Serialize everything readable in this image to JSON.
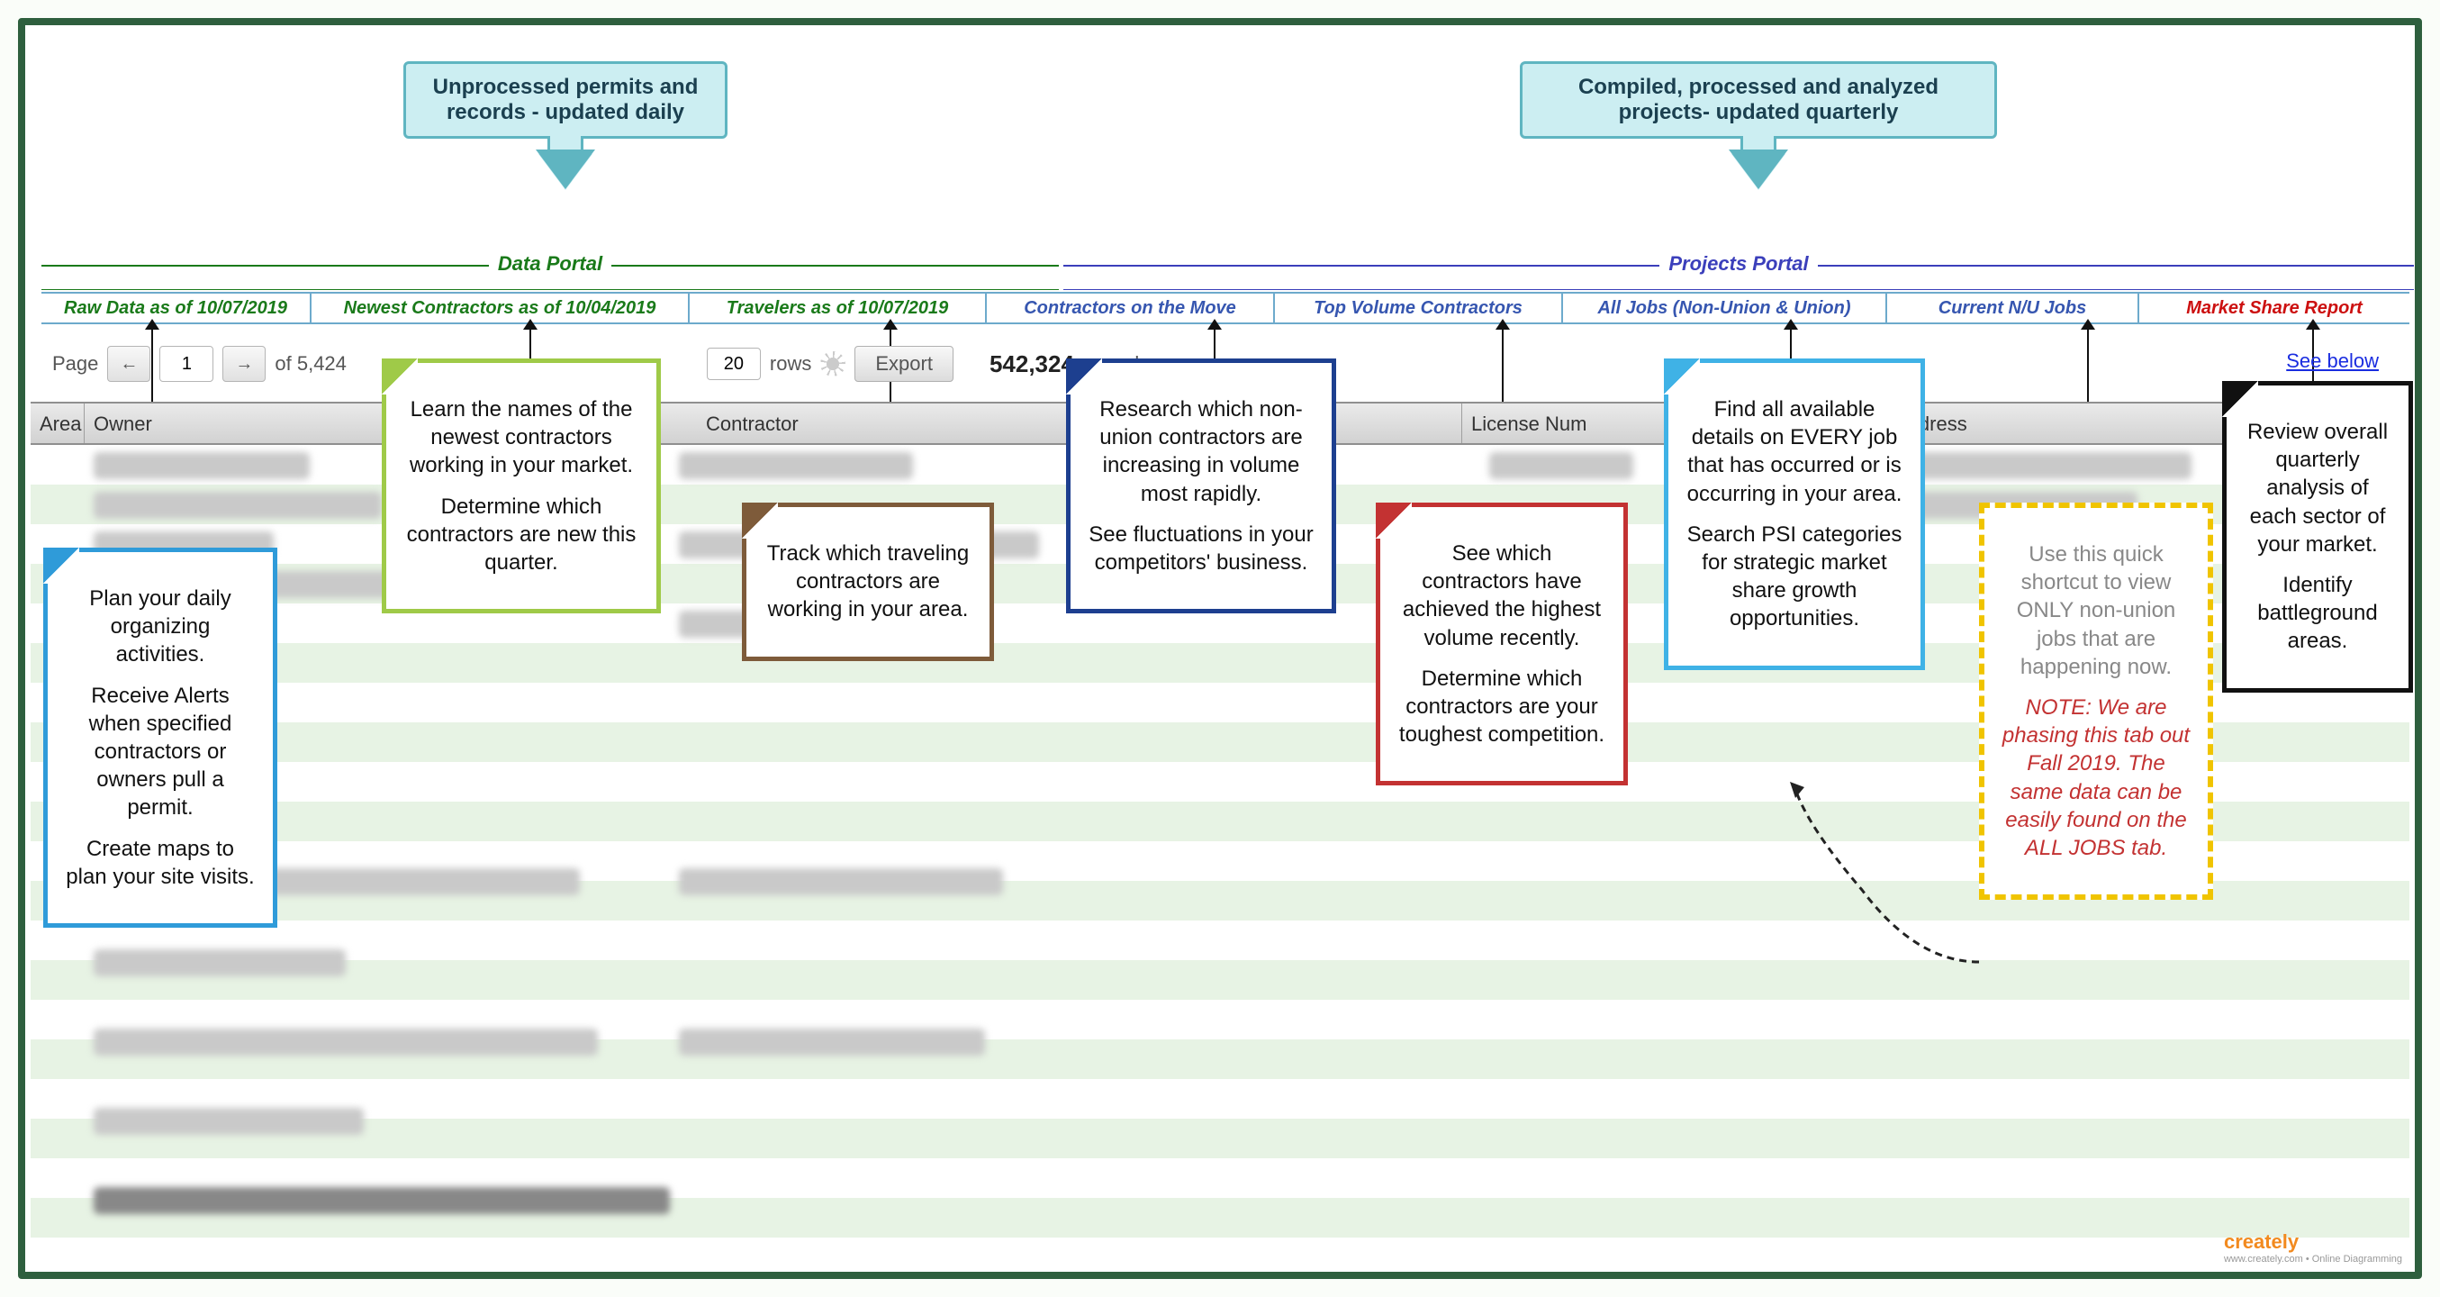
{
  "top_callouts": {
    "left": "Unprocessed permits and records - updated daily",
    "right": "Compiled, processed and analyzed projects- updated quarterly"
  },
  "portals": {
    "data": "Data Portal",
    "projects": "Projects Portal"
  },
  "tabs": {
    "raw_data": "Raw Data as of 10/07/2019",
    "newest_contractors": "Newest Contractors as of 10/04/2019",
    "travelers": "Travelers as of 10/07/2019",
    "contractors_move": "Contractors on the Move",
    "top_volume": "Top Volume Contractors",
    "all_jobs": "All Jobs (Non-Union & Union)",
    "current_nu": "Current N/U Jobs",
    "market_share": "Market Share Report"
  },
  "pager": {
    "page_label": "Page",
    "page_value": "1",
    "total_pages": "of 5,424",
    "rows_value": "20",
    "rows_label": "rows",
    "export": "Export",
    "record_count": "542,324",
    "record_label": "records"
  },
  "see_below": "See below",
  "columns": {
    "area": "Area",
    "owner": "Owner",
    "contractor": "Contractor",
    "license": "License Num",
    "address": "Address"
  },
  "notes": {
    "raw_data": {
      "p1": "Plan your daily organizing activities.",
      "p2": "Receive Alerts when specified contractors or owners pull a permit.",
      "p3": "Create maps to plan your site visits."
    },
    "newest": {
      "p1": "Learn the names of the newest contractors working in your market.",
      "p2": "Determine which contractors are new this quarter."
    },
    "travelers": {
      "p1": "Track which traveling contractors are working in your area."
    },
    "move": {
      "p1": "Research which non-union contractors are increasing in volume most rapidly.",
      "p2": "See fluctuations in your competitors' business."
    },
    "top_volume": {
      "p1": "See which contractors have achieved the highest volume recently.",
      "p2": "Determine which contractors are your toughest competition."
    },
    "all_jobs": {
      "p1": "Find all available details on EVERY job that has occurred or is occurring in your area.",
      "p2": "Search PSI categories for strategic market share growth opportunities."
    },
    "current_nu": {
      "p1": "Use this quick shortcut to view ONLY non-union jobs that are happening now.",
      "note": "NOTE: We are phasing this tab out Fall 2019. The same data can be easily found on the ALL JOBS tab."
    },
    "market_share": {
      "p1": "Review overall quarterly analysis of each sector of your market.",
      "p2": "Identify battleground areas."
    }
  },
  "footer": {
    "brand": "creately",
    "tagline": "www.creately.com • Online Diagramming"
  }
}
